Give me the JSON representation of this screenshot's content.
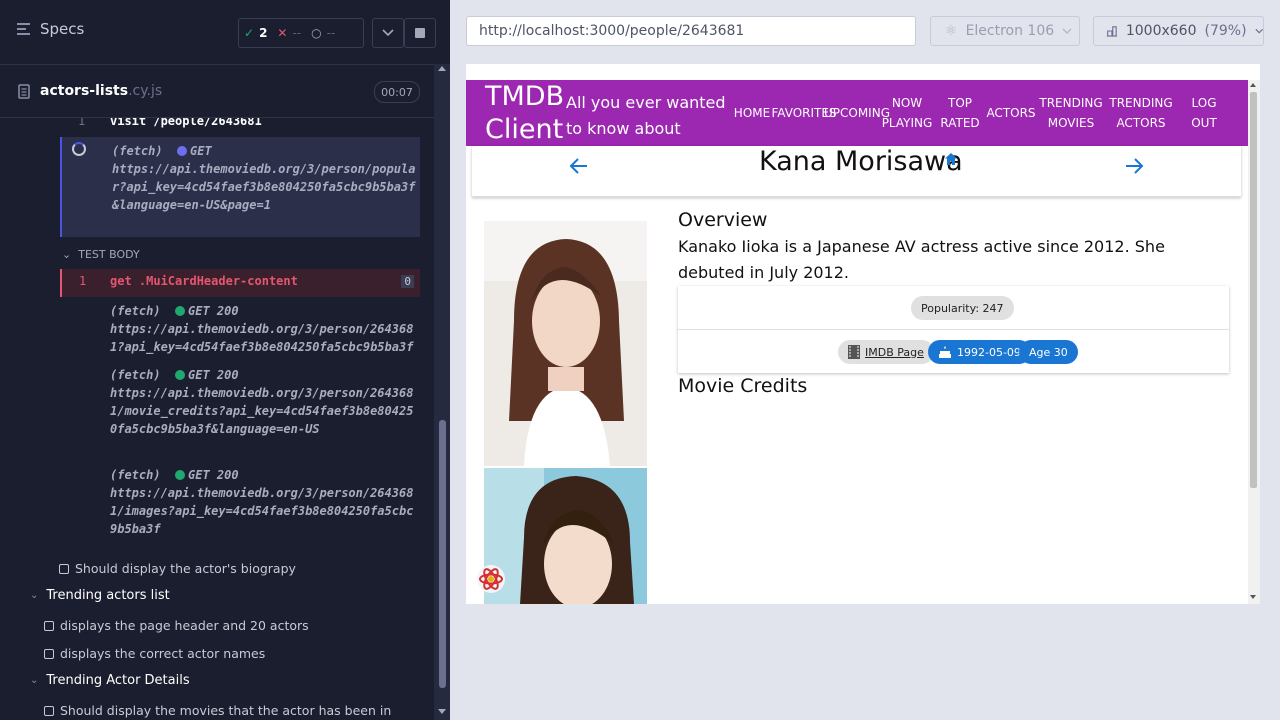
{
  "runner": {
    "specs_label": "Specs",
    "passed_count": "2",
    "failed_count": "--",
    "pending_count": "--",
    "file_name": "actors-lists",
    "file_ext": ".cy.js",
    "duration": "00:07"
  },
  "commands": [
    {
      "num": "1",
      "text": "visit  /people/2643681"
    },
    {
      "num": "",
      "prefix": "(fetch)",
      "method": "GET",
      "url": "https://api.themoviedb.org/3/person/popular?api_key=4cd54faef3b8e804250fa5cbc9b5ba3f&language=en-US&page=1",
      "status_color": "#6e6ef0"
    },
    {
      "num": "1",
      "text": "get  .MuiCardHeader-content",
      "count": "0"
    },
    {
      "prefix": "(fetch)",
      "method": "GET 200",
      "url": "https://api.themoviedb.org/3/person/2643681?api_key=4cd54faef3b8e804250fa5cbc9b5ba3f",
      "status_color": "#1fa971"
    },
    {
      "prefix": "(fetch)",
      "method": "GET 200",
      "url": "https://api.themoviedb.org/3/person/2643681/movie_credits?api_key=4cd54faef3b8e804250fa5cbc9b5ba3f&language=en-US",
      "status_color": "#1fa971"
    },
    {
      "prefix": "(fetch)",
      "method": "GET 200",
      "url": "https://api.themoviedb.org/3/person/2643681/images?api_key=4cd54faef3b8e804250fa5cbc9b5ba3f",
      "status_color": "#1fa971"
    }
  ],
  "test_body_label": "TEST BODY",
  "tests": [
    {
      "label": "Should display the actor's biograpy"
    },
    {
      "suite": "Trending actors list"
    },
    {
      "label": "displays the page header and 20 actors"
    },
    {
      "label": "displays the correct actor names"
    },
    {
      "suite": "Trending Actor Details"
    },
    {
      "label": "Should display the movies that the actor has been in"
    }
  ],
  "browser": {
    "url": "http://localhost:3000/people/2643681",
    "browser_name": "Electron 106",
    "viewport": "1000x660",
    "zoom": "(79%)"
  },
  "app": {
    "brand": "TMDB Client",
    "tagline": "All you ever wanted to know about Movies!",
    "nav": [
      "HOME",
      "FAVORITES",
      "UPCOMING",
      "NOW PLAYING",
      "TOP RATED",
      "ACTORS",
      "TRENDING MOVIES",
      "TRENDING ACTORS",
      "LOG OUT"
    ],
    "actor_name": "Kana Morisawa",
    "overview_title": "Overview",
    "biography": "Kanako Iioka is a Japanese AV actress active since 2012. She debuted in July 2012.",
    "popularity": "Popularity: 247",
    "imdb_label": "IMDB Page",
    "birthday": "1992-05-09",
    "age": "Age 30",
    "credits_title": "Movie Credits"
  },
  "colors": {
    "appbar": "#9c27b0",
    "chip_primary": "#1976d2",
    "arrow": "#1976d2"
  }
}
